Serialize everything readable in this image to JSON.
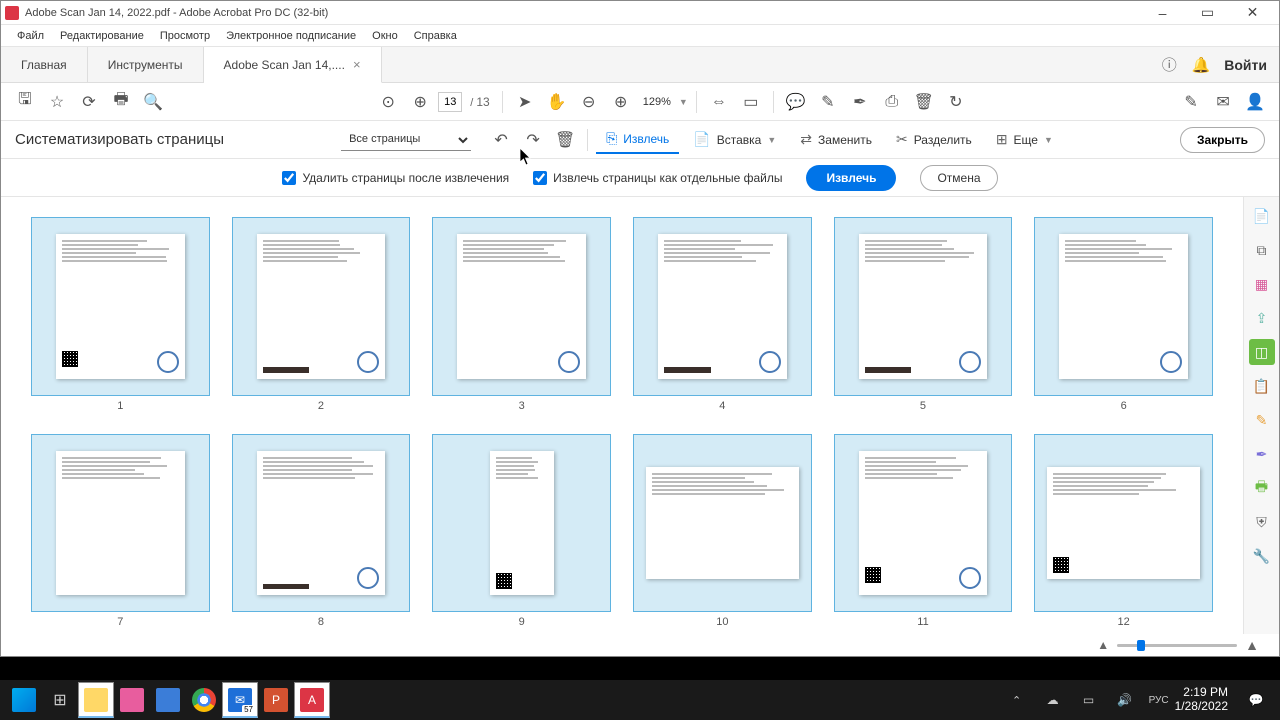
{
  "window": {
    "title": "Adobe Scan Jan 14, 2022.pdf - Adobe Acrobat Pro DC (32-bit)"
  },
  "menu": {
    "items": [
      "Файл",
      "Редактирование",
      "Просмотр",
      "Электронное подписание",
      "Окно",
      "Справка"
    ]
  },
  "tabs": {
    "home": "Главная",
    "tools": "Инструменты",
    "doc": "Adobe Scan Jan 14,...."
  },
  "login": "Войти",
  "toolbar": {
    "page_current": "13",
    "page_total": "13",
    "zoom": "129%"
  },
  "panel": {
    "title": "Систематизировать страницы",
    "dropdown": "Все страницы",
    "extract": "Извлечь",
    "insert": "Вставка",
    "replace": "Заменить",
    "split": "Разделить",
    "more": "Еще",
    "close": "Закрыть"
  },
  "options": {
    "delete_after": "Удалить страницы после извлечения",
    "as_separate": "Извлечь страницы как отдельные файлы",
    "extract_btn": "Извлечь",
    "cancel_btn": "Отмена"
  },
  "pages": [
    "1",
    "2",
    "3",
    "4",
    "5",
    "6",
    "7",
    "8",
    "9",
    "10",
    "11",
    "12"
  ],
  "taskbar": {
    "time": "2:19 PM",
    "date": "1/28/2022",
    "lang": "РУС",
    "mail_badge": "57"
  }
}
